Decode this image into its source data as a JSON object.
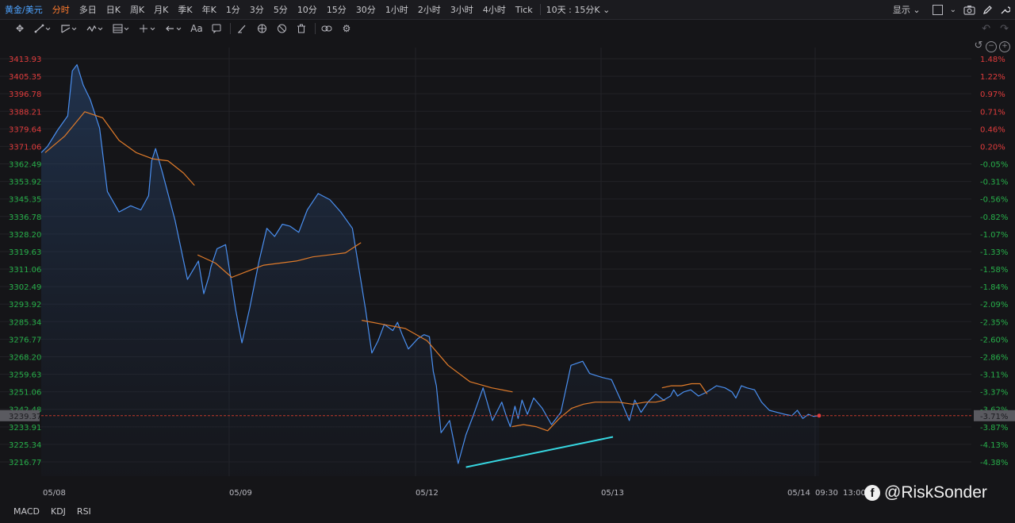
{
  "header": {
    "symbol": "黄金/美元",
    "timeframes": [
      "分时",
      "多日",
      "日K",
      "周K",
      "月K",
      "季K",
      "年K",
      "1分",
      "3分",
      "5分",
      "10分",
      "15分",
      "30分",
      "1小时",
      "2小时",
      "3小时",
      "4小时",
      "Tick"
    ],
    "active_timeframe": "分时",
    "range_label": "10天 : 15分K",
    "display_label": "显示"
  },
  "toolbar": {
    "tools": [
      "move-icon",
      "line-icon",
      "channel-icon",
      "wave-icon",
      "fib-icon",
      "measure-icon",
      "arrow-icon",
      "text-label-icon",
      "note-icon",
      "brush-icon",
      "eye-icon",
      "hide-icon",
      "trash-icon",
      "link-icon",
      "settings-icon"
    ],
    "text_tool_label": "Aa"
  },
  "indicators": [
    "MACD",
    "KDJ",
    "RSI"
  ],
  "watermark": {
    "text": "@RiskSonder",
    "badge": "f"
  },
  "colors": {
    "price_line": "#4a8ff0",
    "ma_line": "#e07b2a",
    "trend_line": "#36d6e0",
    "up_label": "#e03c3c",
    "down_label": "#27b04a",
    "current_price_line": "#c0392b"
  },
  "chart_data": {
    "type": "line",
    "title": "",
    "ylabel": "",
    "xlabel": "",
    "ylim": [
      3212.5,
      3418.2
    ],
    "y_ticks": [
      "3413.93",
      "3405.35",
      "3396.78",
      "3388.21",
      "3379.64",
      "3371.06",
      "3362.49",
      "3353.92",
      "3345.35",
      "3336.78",
      "3328.20",
      "3319.63",
      "3311.06",
      "3302.49",
      "3293.92",
      "3285.34",
      "3276.77",
      "3268.20",
      "3259.63",
      "3251.06",
      "3242.48",
      "3233.91",
      "3225.34",
      "3216.77"
    ],
    "pct_ticks": [
      "1.48%",
      "1.22%",
      "0.97%",
      "0.71%",
      "0.46%",
      "0.20%",
      "-0.05%",
      "-0.31%",
      "-0.56%",
      "-0.82%",
      "-1.07%",
      "-1.33%",
      "-1.58%",
      "-1.84%",
      "-2.09%",
      "-2.35%",
      "-2.60%",
      "-2.86%",
      "-3.11%",
      "-3.37%",
      "-3.62%",
      "-3.87%",
      "-4.13%",
      "-4.38%"
    ],
    "x_labels": [
      "05/08",
      "05/09",
      "05/12",
      "05/13",
      "05/14",
      "09:30",
      "13:00"
    ],
    "current_price": "3239.37",
    "current_pct": "-3.71%",
    "series": [
      {
        "key": "price",
        "x": [
          0,
          0.8,
          2.1,
          3.4,
          4.0,
          4.6,
          5.4,
          6.3,
          7.5,
          8.5,
          10.0,
          11.5,
          12.8,
          13.8,
          14.2,
          14.7,
          15.6,
          17.2,
          18.8,
          20.2,
          20.9,
          21.6,
          21.8,
          22.6,
          23.7,
          25.0,
          25.8,
          26.8,
          28.0,
          29.0,
          30.0,
          31.0,
          32.0,
          33.1,
          34.2,
          35.6,
          37.1,
          38.5,
          40.0,
          41.7,
          42.5,
          43.3,
          44.1,
          45.2,
          45.8,
          46.4,
          47.2,
          48.4,
          49.2,
          49.9,
          50.4,
          50.8,
          51.4,
          52.5,
          53.6,
          54.6,
          55.6,
          56.8,
          58.0,
          59.2,
          59.8,
          60.3,
          60.9,
          61.3,
          61.8,
          62.5,
          63.3,
          64.4,
          65.6,
          66.8,
          68.1,
          69.6,
          70.5,
          71.3,
          72.2,
          73.3,
          74.5,
          75.6,
          76.3,
          77.1,
          78.0,
          79.0,
          80.0,
          80.9,
          81.3,
          81.8,
          82.6,
          83.5,
          84.5,
          85.6,
          86.8,
          87.9,
          88.8,
          89.3,
          90.0,
          90.7,
          91.7,
          92.6,
          93.6,
          94.6,
          95.6,
          96.5,
          97.2,
          97.9,
          98.6,
          99.3,
          100
        ],
        "values": [
          3368,
          3371,
          3379,
          3386,
          3408,
          3411,
          3401,
          3394,
          3380,
          3349,
          3339,
          3342,
          3340,
          3347,
          3364,
          3370,
          3358,
          3335,
          3306,
          3315,
          3299,
          3308,
          3312,
          3321,
          3323,
          3291,
          3275,
          3292,
          3315,
          3331,
          3327,
          3333,
          3332,
          3329,
          3340,
          3348,
          3345,
          3339,
          3331,
          3291,
          3270,
          3276,
          3284,
          3281,
          3285,
          3279,
          3272,
          3277,
          3279,
          3278,
          3261,
          3254,
          3231,
          3237,
          3216,
          3230,
          3240,
          3253,
          3237,
          3246,
          3239,
          3234,
          3244,
          3238,
          3247,
          3240,
          3248,
          3243,
          3235,
          3241,
          3264,
          3266,
          3260,
          3259,
          3258,
          3257,
          3247,
          3237,
          3247,
          3241,
          3246,
          3250,
          3247,
          3249,
          3252,
          3249,
          3251,
          3252,
          3249,
          3251,
          3254,
          3253,
          3251,
          3248,
          3254,
          3253,
          3252,
          3246,
          3242,
          3241,
          3240,
          3239.37,
          3242,
          3238,
          3240,
          3239,
          3239.37
        ]
      },
      {
        "key": "ma_a",
        "x": [
          0.5,
          3.0,
          5.6,
          7.9,
          10.0,
          12.2,
          14.3,
          16.3,
          18.3,
          19.7
        ],
        "values": [
          3368,
          3376,
          3388,
          3385,
          3374,
          3368,
          3365,
          3364,
          3358,
          3352
        ]
      },
      {
        "key": "ma_b",
        "x": [
          20.1,
          22.4,
          24.5,
          26.5,
          28.6,
          30.7,
          32.8,
          34.9,
          37.0,
          39.1,
          41.1
        ],
        "values": [
          3318,
          3314,
          3307,
          3310,
          3313,
          3314,
          3315,
          3317,
          3318,
          3319,
          3324
        ]
      },
      {
        "key": "ma_c",
        "x": [
          41.2,
          44.0,
          46.8,
          49.6,
          52.3,
          55.1,
          57.9,
          60.6
        ],
        "values": [
          3286,
          3284,
          3282,
          3276,
          3264,
          3256,
          3253,
          3251
        ]
      },
      {
        "key": "ma_d",
        "x": [
          60.5,
          62.0,
          63.6,
          65.1,
          66.6,
          68.2,
          69.7,
          71.2,
          72.8,
          74.2,
          76.0,
          77.7,
          79.0,
          80.2
        ],
        "values": [
          3234,
          3235,
          3234,
          3232,
          3238,
          3243,
          3245,
          3246,
          3246,
          3246,
          3245,
          3246,
          3246,
          3247
        ]
      },
      {
        "key": "ma_e",
        "x": [
          79.8,
          81.0,
          82.3,
          83.6,
          84.7,
          85.6
        ],
        "values": [
          3253,
          3254,
          3254,
          3255,
          3255,
          3250
        ]
      },
      {
        "key": "trend",
        "x": [
          54.6,
          73.5
        ],
        "values": [
          3214.2,
          3229.0
        ]
      }
    ]
  }
}
